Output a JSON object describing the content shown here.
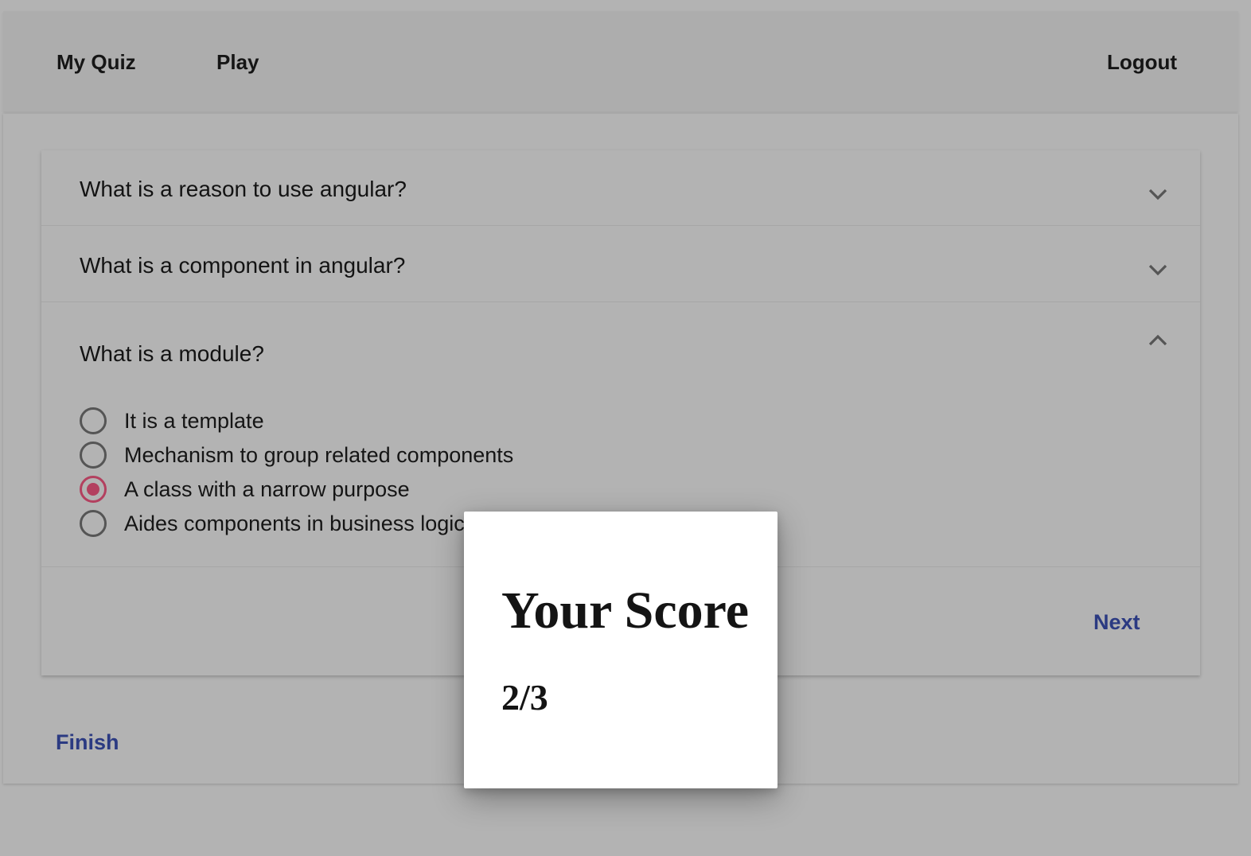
{
  "toolbar": {
    "nav": [
      "My Quiz",
      "Play"
    ],
    "logout_label": "Logout"
  },
  "questions": [
    {
      "title": "What is a reason to use angular?",
      "expanded": false,
      "icon": "chevron-down-icon"
    },
    {
      "title": "What is a component in angular?",
      "expanded": false,
      "icon": "chevron-down-icon"
    },
    {
      "title": "What is a module?",
      "expanded": true,
      "icon": "chevron-up-icon",
      "options": [
        {
          "label": "It is a template",
          "checked": false
        },
        {
          "label": "Mechanism to group related components",
          "checked": false
        },
        {
          "label": "A class with a narrow purpose",
          "checked": true
        },
        {
          "label": "Aides components in business logic",
          "checked": false
        }
      ]
    }
  ],
  "actions": {
    "next_label": "Next",
    "finish_label": "Finish"
  },
  "dialog": {
    "title": "Your Score",
    "score": "2/3"
  },
  "colors": {
    "accent": "#b3405f",
    "primary": "#2b3a82"
  }
}
